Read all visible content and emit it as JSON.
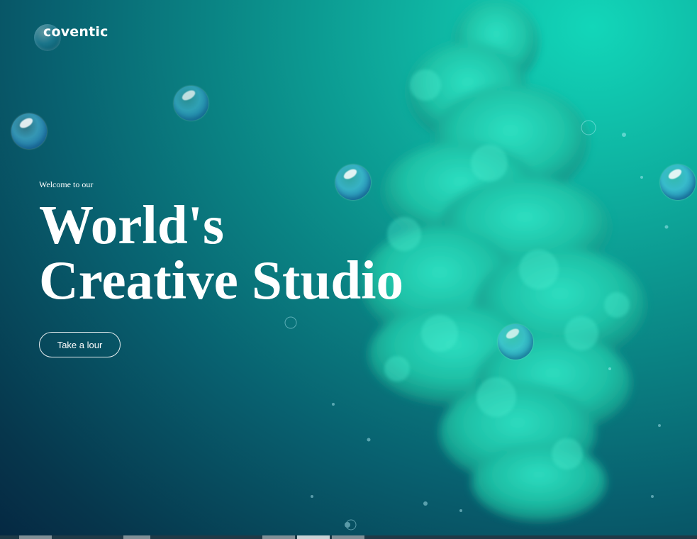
{
  "brand": {
    "name": "coventic"
  },
  "hero": {
    "welcome": "Welcome to our",
    "headline_line1": "World's",
    "headline_line2": "Creative Studio",
    "cta_label": "Take a lour"
  },
  "colors": {
    "accent": "#12d6b9",
    "background_dark": "#052842",
    "text": "#ffffff"
  }
}
